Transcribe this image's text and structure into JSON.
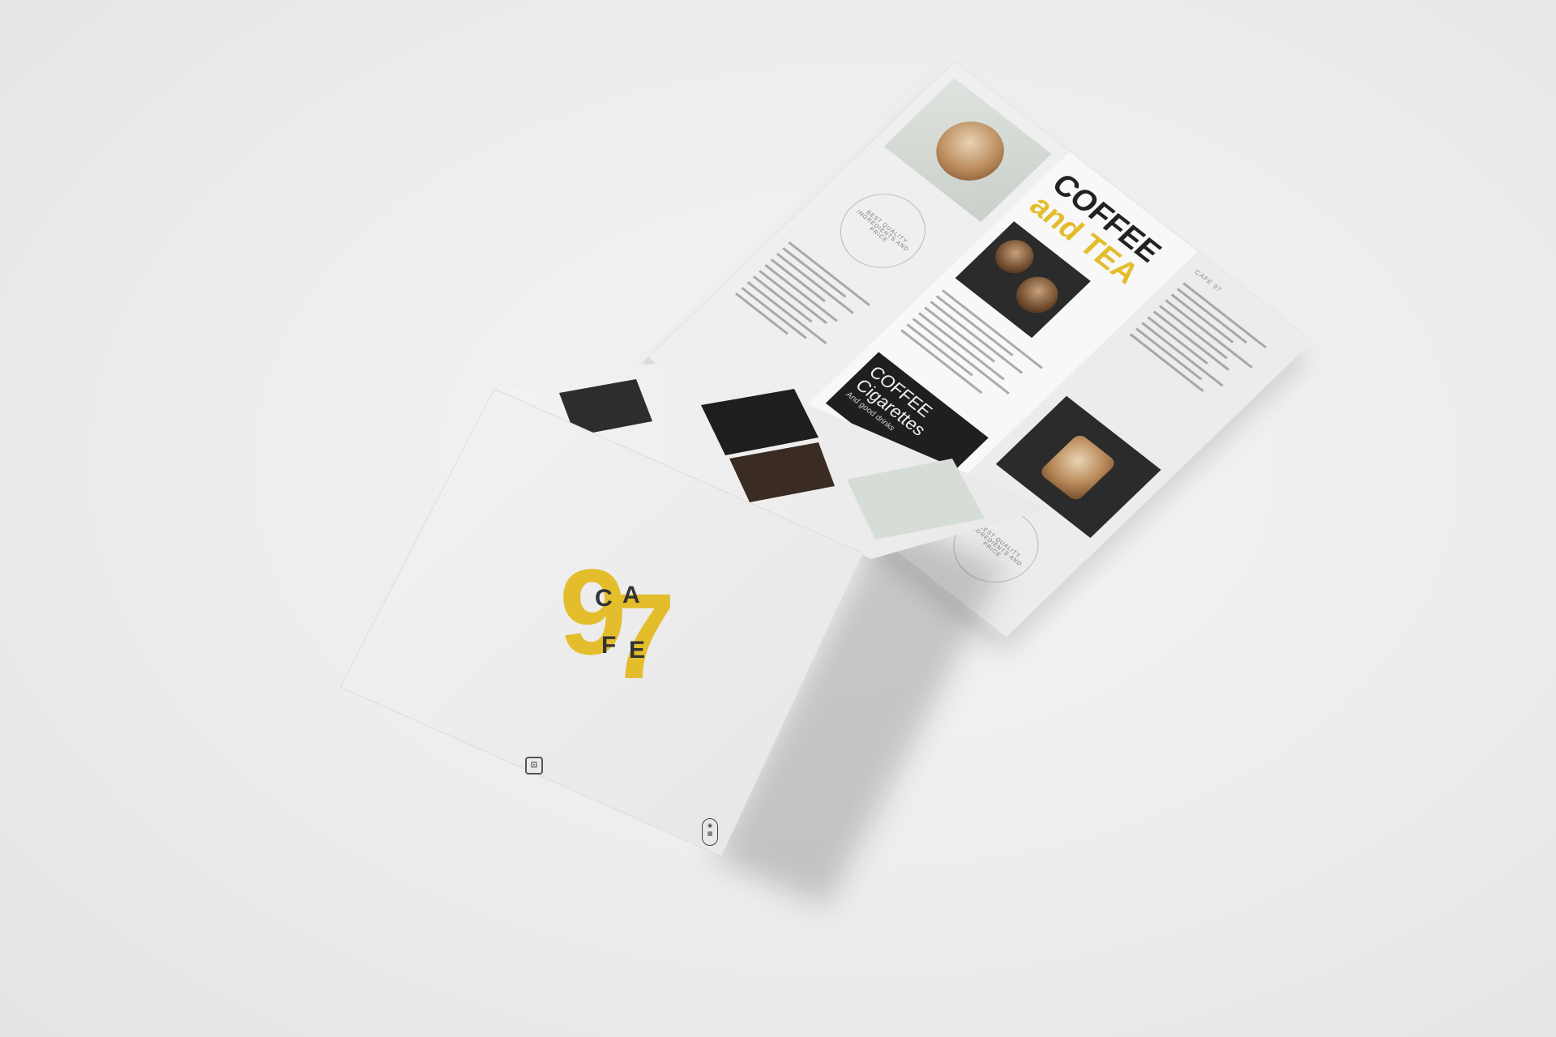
{
  "brand": {
    "name": "CAFE 97",
    "number_first": "9",
    "number_second": "7",
    "letters": [
      "C",
      "A",
      "F",
      "E"
    ],
    "accent_color": "#e3bd2c",
    "text_color": "#333333"
  },
  "menu_inside": {
    "heading_line1": "COFFEE",
    "heading_line2": "and TEA",
    "secondary_heading_line1": "COFFEE",
    "secondary_heading_line2": "Cigarettes",
    "secondary_tagline": "And good drinks",
    "ring_text": "BEST QUALITY INGREDIENTS AND PRICE",
    "corner_label": "CAFE 97"
  },
  "icons": {
    "cover_mark": "cafe-logo-mark-icon",
    "cover_badge": "qr-badge-icon"
  },
  "scene": {
    "background_color": "#ececec",
    "paper_color": "#f6f6f6"
  }
}
